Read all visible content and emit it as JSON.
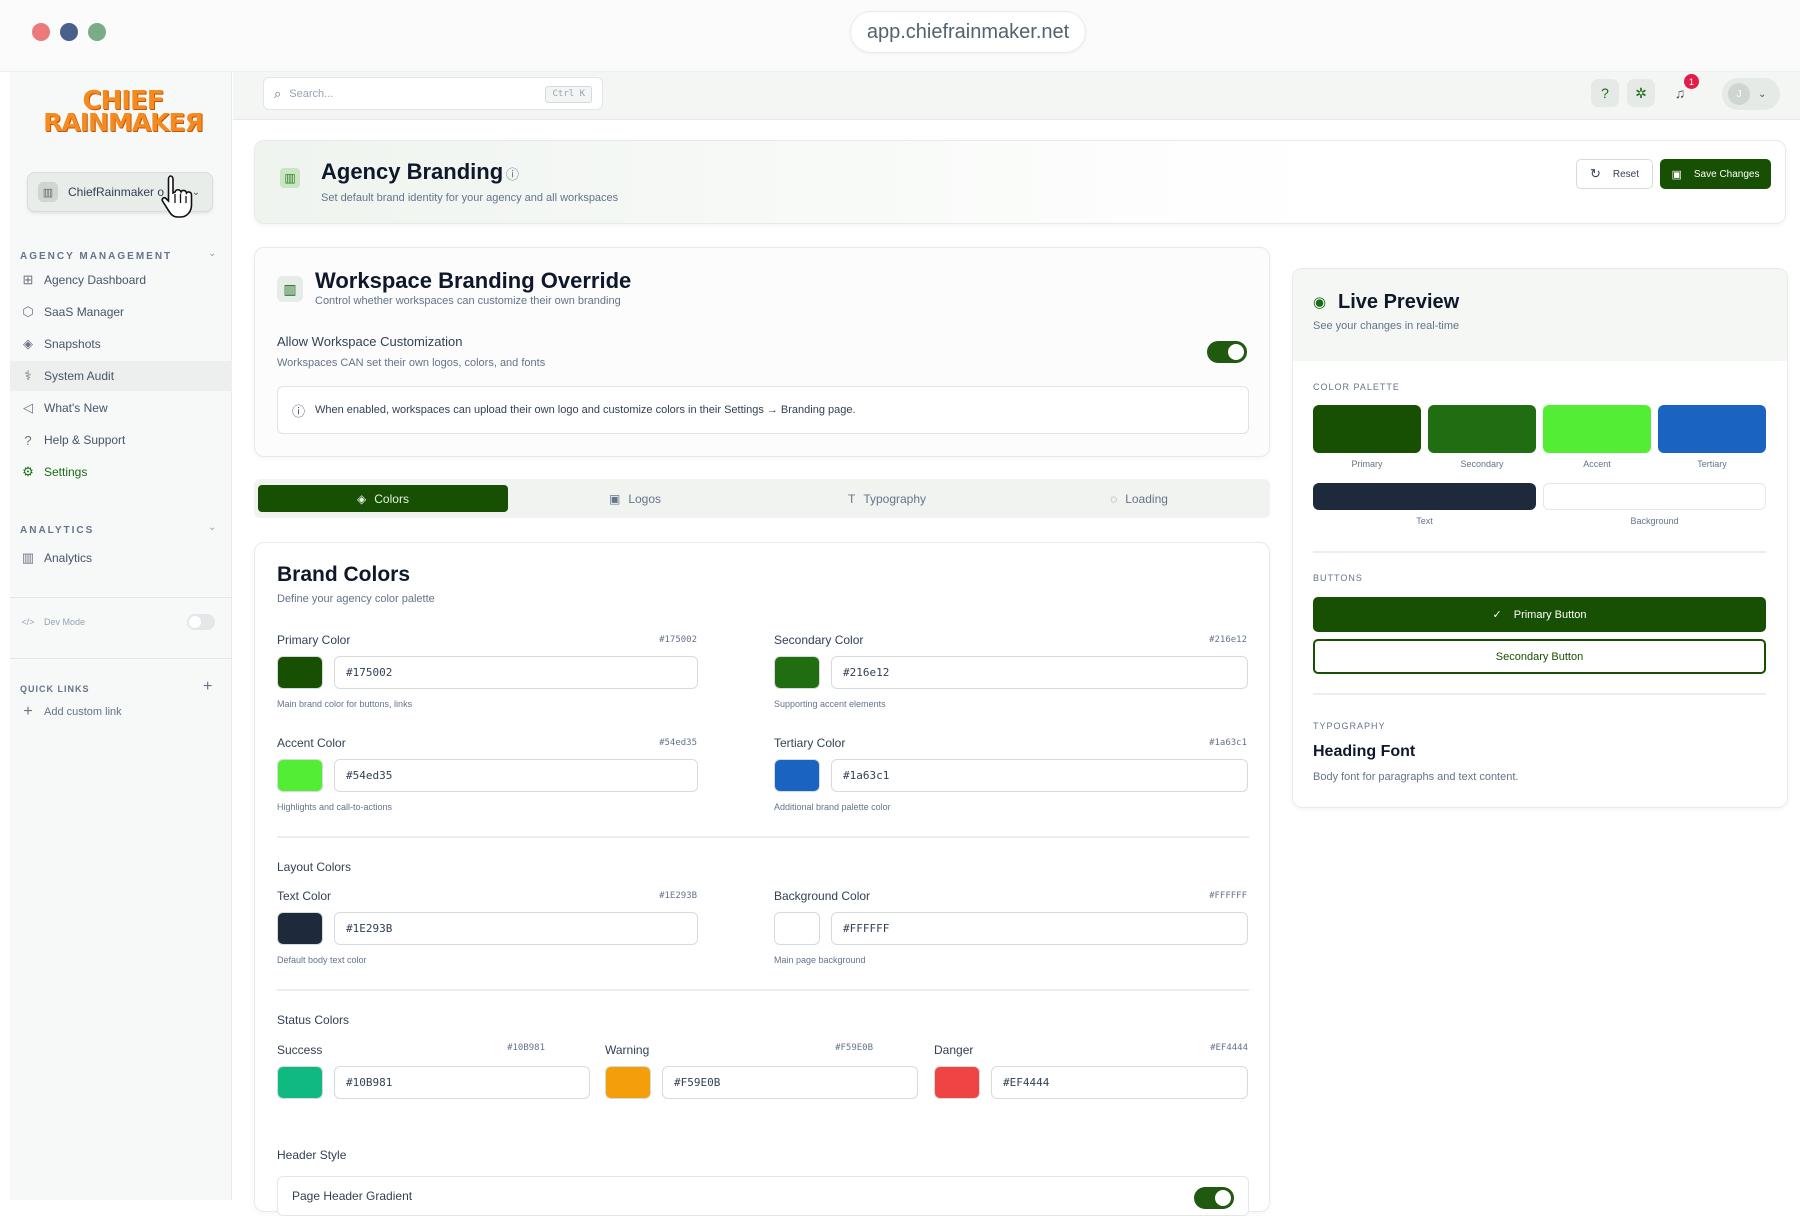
{
  "browser": {
    "url": "app.chiefrainmaker.net",
    "dots": [
      "#ec7a7a",
      "#4a5f8b",
      "#7aac86"
    ]
  },
  "sidebar": {
    "logo": {
      "line1": "CHIEF",
      "line2": "RAINMAKEЯ"
    },
    "workspace": "ChiefRainmaker o",
    "sections": {
      "agency": "AGENCY MANAGEMENT",
      "analytics": "ANALYTICS",
      "quick_links": "QUICK LINKS"
    },
    "items": [
      {
        "label": "Agency Dashboard",
        "icon": "grid-icon"
      },
      {
        "label": "SaaS Manager",
        "icon": "cube-icon"
      },
      {
        "label": "Snapshots",
        "icon": "layers-icon"
      },
      {
        "label": "System Audit",
        "icon": "stethoscope-icon"
      },
      {
        "label": "What's New",
        "icon": "megaphone-icon"
      },
      {
        "label": "Help & Support",
        "icon": "help-icon"
      },
      {
        "label": "Settings",
        "icon": "gear-icon"
      }
    ],
    "analytics_item": "Analytics",
    "dev_mode": "Dev Mode",
    "add_link": "Add custom link"
  },
  "topbar": {
    "search_placeholder": "Search...",
    "shortcut": "Ctrl K",
    "notifications": "1",
    "avatar_initial": "J"
  },
  "header": {
    "title": "Agency Branding",
    "subtitle": "Set default brand identity for your agency and all workspaces",
    "reset": "Reset",
    "save": "Save Changes"
  },
  "override": {
    "title": "Workspace Branding Override",
    "subtitle": "Control whether workspaces can customize their own branding",
    "allow_label": "Allow Workspace Customization",
    "allow_desc": "Workspaces CAN set their own logos, colors, and fonts",
    "info": "When enabled, workspaces can upload their own logo and customize colors in their Settings → Branding page."
  },
  "tabs": [
    "Colors",
    "Logos",
    "Typography",
    "Loading"
  ],
  "brand": {
    "title": "Brand Colors",
    "subtitle": "Define your agency color palette",
    "primary": {
      "label": "Primary Color",
      "hex": "#175002",
      "hint": "Main brand color for buttons, links"
    },
    "secondary": {
      "label": "Secondary Color",
      "hex": "#216e12",
      "hint": "Supporting accent elements"
    },
    "accent": {
      "label": "Accent Color",
      "hex": "#54ed35",
      "hint": "Highlights and call-to-actions"
    },
    "tertiary": {
      "label": "Tertiary Color",
      "hex": "#1a63c1",
      "hint": "Additional brand palette color"
    },
    "layout_title": "Layout Colors",
    "text": {
      "label": "Text Color",
      "hex": "#1E293B",
      "hint": "Default body text color"
    },
    "background": {
      "label": "Background Color",
      "hex": "#FFFFFF",
      "hint": "Main page background"
    },
    "status_title": "Status Colors",
    "success": {
      "label": "Success",
      "hex": "#10B981"
    },
    "warning": {
      "label": "Warning",
      "hex": "#F59E0B"
    },
    "danger": {
      "label": "Danger",
      "hex": "#EF4444"
    },
    "header_style": "Header Style",
    "gradient_label": "Page Header Gradient"
  },
  "preview": {
    "title": "Live Preview",
    "subtitle": "See your changes in real-time",
    "palette_title": "COLOR PALETTE",
    "swatches": [
      "Primary",
      "Secondary",
      "Accent",
      "Tertiary",
      "Text",
      "Background"
    ],
    "buttons_title": "BUTTONS",
    "primary_button": "Primary Button",
    "secondary_button": "Secondary Button",
    "typography_title": "TYPOGRAPHY",
    "heading_font": "Heading Font",
    "body_font": "Body font for paragraphs and text content."
  }
}
